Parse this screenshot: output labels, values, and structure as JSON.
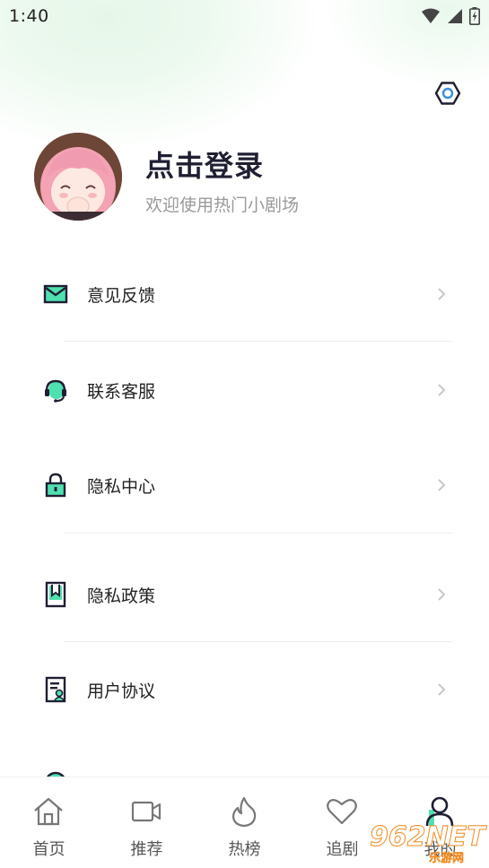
{
  "status_bar": {
    "time": "1:40",
    "icons": [
      "wifi-icon",
      "signal-icon",
      "battery-charging-icon"
    ]
  },
  "header": {
    "settings_icon": "settings-hexagon-icon"
  },
  "profile": {
    "title": "点击登录",
    "subtitle": "欢迎使用热门小剧场"
  },
  "menu": {
    "items": [
      {
        "label": "意见反馈",
        "icon": "mail-icon"
      },
      {
        "label": "联系客服",
        "icon": "headset-icon"
      },
      {
        "label": "隐私中心",
        "icon": "lock-icon"
      },
      {
        "label": "隐私政策",
        "icon": "bookmark-doc-icon"
      },
      {
        "label": "用户协议",
        "icon": "user-doc-icon"
      }
    ]
  },
  "bottom_nav": {
    "items": [
      {
        "label": "首页",
        "icon": "home-icon"
      },
      {
        "label": "推荐",
        "icon": "video-icon"
      },
      {
        "label": "热榜",
        "icon": "flame-icon"
      },
      {
        "label": "追剧",
        "icon": "heart-icon"
      },
      {
        "label": "我的",
        "icon": "user-icon"
      }
    ]
  },
  "watermark": {
    "big": "962NET",
    "small": "乐游网"
  },
  "colors": {
    "accent": "#3fd9a8",
    "icon_dark": "#1f1f33"
  }
}
